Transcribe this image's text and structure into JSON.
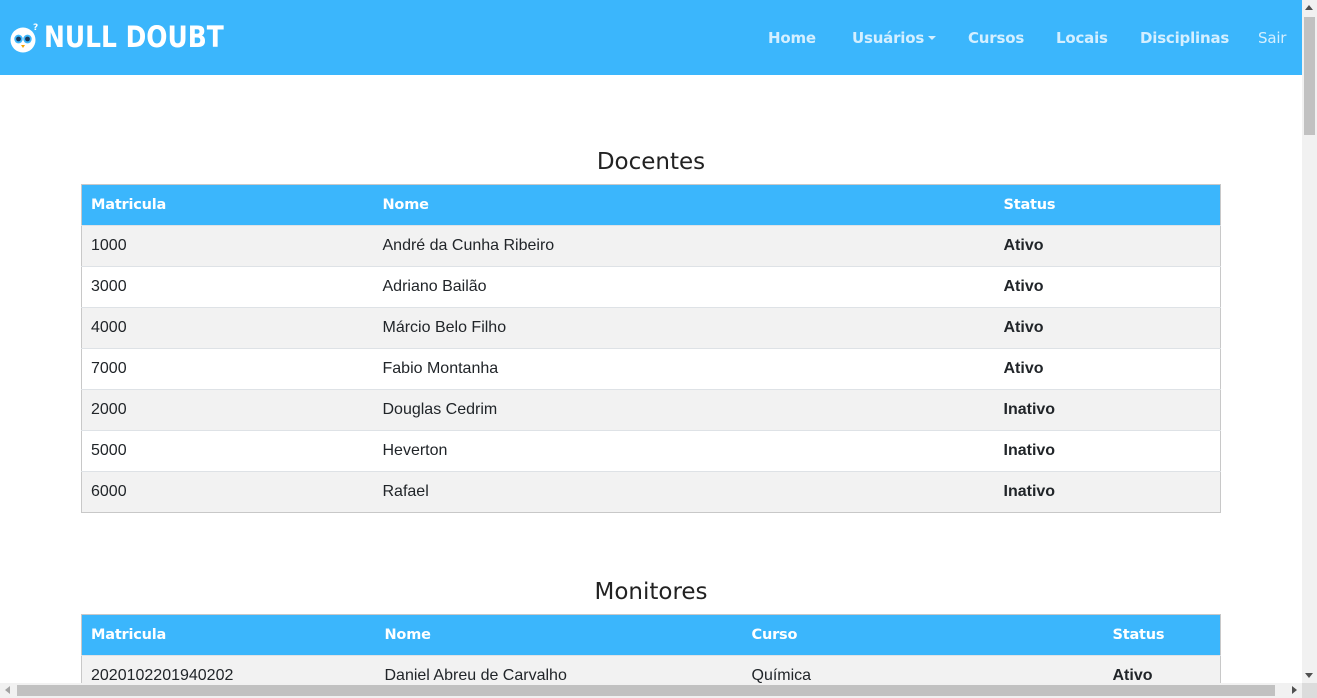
{
  "brand": {
    "name": "NULL DOUBT",
    "logo_icon": "penguin-logo-icon"
  },
  "nav": {
    "home": "Home",
    "usuarios": "Usuários",
    "cursos": "Cursos",
    "locais": "Locais",
    "disciplinas": "Disciplinas",
    "sair": "Sair"
  },
  "colors": {
    "accent": "#3bb6fc",
    "ativo": "#008000",
    "inativo": "#ff0000"
  },
  "docentes": {
    "title": "Docentes",
    "headers": [
      "Matricula",
      "Nome",
      "Status"
    ],
    "rows": [
      {
        "matricula": "1000",
        "nome": "André da Cunha Ribeiro",
        "status": "Ativo"
      },
      {
        "matricula": "3000",
        "nome": "Adriano Bailão",
        "status": "Ativo"
      },
      {
        "matricula": "4000",
        "nome": "Márcio Belo Filho",
        "status": "Ativo"
      },
      {
        "matricula": "7000",
        "nome": "Fabio Montanha",
        "status": "Ativo"
      },
      {
        "matricula": "2000",
        "nome": "Douglas Cedrim",
        "status": "Inativo"
      },
      {
        "matricula": "5000",
        "nome": "Heverton",
        "status": "Inativo"
      },
      {
        "matricula": "6000",
        "nome": "Rafael",
        "status": "Inativo"
      }
    ]
  },
  "monitores": {
    "title": "Monitores",
    "headers": [
      "Matricula",
      "Nome",
      "Curso",
      "Status"
    ],
    "rows": [
      {
        "matricula": "2020102201940202",
        "nome": "Daniel Abreu de Carvalho",
        "curso": "Química",
        "status": "Ativo"
      }
    ]
  }
}
